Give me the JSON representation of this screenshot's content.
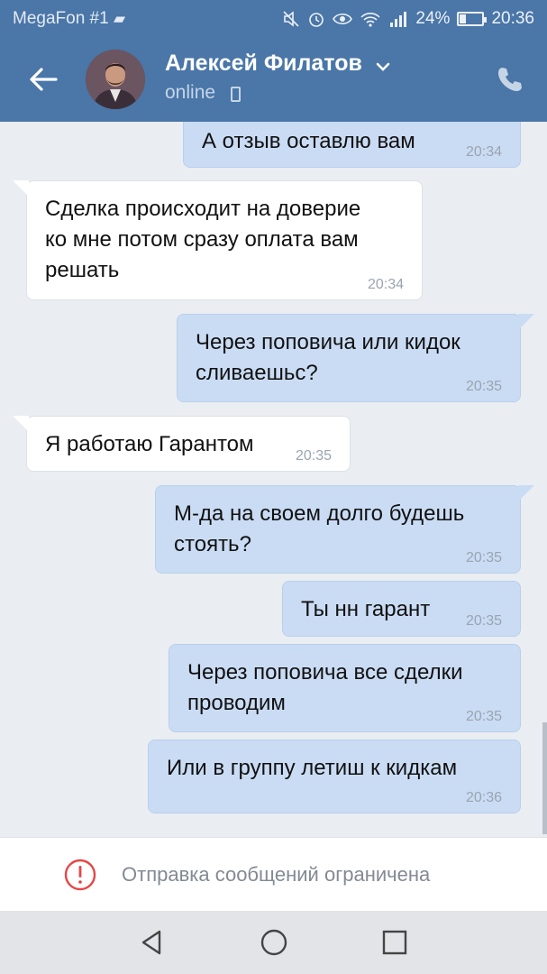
{
  "statusbar": {
    "carrier": "MegaFon #1",
    "battery_text": "24%",
    "battery_level": 0.24,
    "time": "20:36",
    "icons": [
      "gamepad-icon",
      "mute-icon",
      "alarm-icon",
      "eye-icon",
      "wifi-icon",
      "signal-icon",
      "battery-icon"
    ]
  },
  "header": {
    "contact_name": "Алексей Филатов",
    "status": "online",
    "icons": [
      "back-arrow-icon",
      "chevron-down-icon",
      "mobile-phone-icon",
      "call-icon"
    ]
  },
  "messages": [
    {
      "dir": "out",
      "text": "А отзыв оставлю вам",
      "time": "20:34"
    },
    {
      "dir": "in",
      "text": "Сделка происходит на доверие\nко мне потом сразу оплата вам\nрешать",
      "time": "20:34"
    },
    {
      "dir": "out",
      "text": "Через поповича или кидок\nсливаешьс?",
      "time": "20:35"
    },
    {
      "dir": "in",
      "text": "Я работаю Гарантом",
      "time": "20:35"
    },
    {
      "dir": "out",
      "text": "М-да на своем долго будешь\nстоять?",
      "time": "20:35"
    },
    {
      "dir": "out",
      "text": "Ты нн гарант",
      "time": "20:35"
    },
    {
      "dir": "out",
      "text": "Через поповича все сделки\nпроводим",
      "time": "20:35"
    },
    {
      "dir": "out",
      "text": "Или в группу летиш к кидкам",
      "time": "20:36"
    }
  ],
  "restriction": {
    "text": "Отправка сообщений ограничена",
    "icon": "warning-icon",
    "color": "#e64646"
  },
  "navbar": {
    "icons": [
      "nav-back-icon",
      "nav-home-icon",
      "nav-recents-icon"
    ]
  },
  "colors": {
    "header": "#4a76a8",
    "outgoing_bubble": "#cadcf4",
    "incoming_bubble": "#ffffff",
    "chat_background": "#eaedf1"
  }
}
